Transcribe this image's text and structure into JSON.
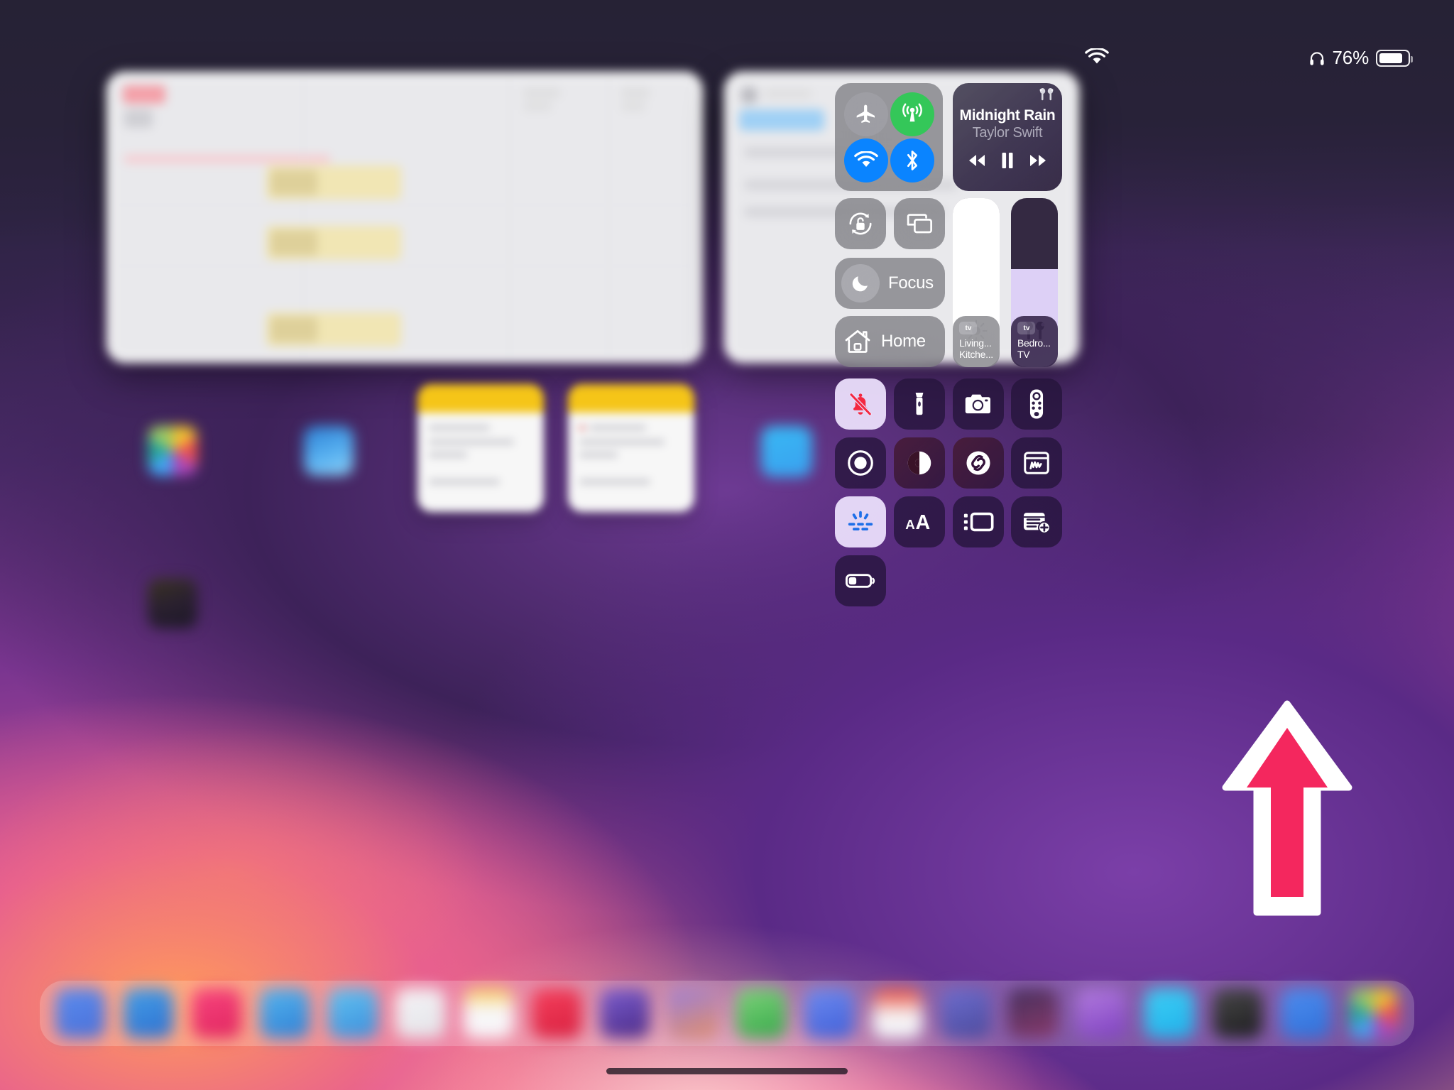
{
  "device": "ipad-control-center",
  "status_bar": {
    "wifi_icon": "wifi-icon",
    "headphones_icon": "headphones-icon",
    "battery_percent": "76%",
    "battery_level": 76
  },
  "control_center": {
    "connectivity": {
      "airplane_mode": {
        "name": "airplane-mode",
        "state": "off"
      },
      "cellular_data": {
        "name": "cellular-data",
        "state": "on"
      },
      "wifi": {
        "name": "wifi",
        "state": "on"
      },
      "bluetooth": {
        "name": "bluetooth",
        "state": "on"
      }
    },
    "media": {
      "track_title": "Midnight Rain",
      "artist": "Taylor Swift",
      "route_icon": "airpods-icon",
      "rewind_label": "Rewind",
      "pause_label": "Pause",
      "forward_label": "Fast Forward"
    },
    "rotation_lock": {
      "label": "Rotation Lock",
      "state": "off"
    },
    "screen_mirroring": {
      "label": "Screen Mirroring"
    },
    "focus": {
      "label": "Focus",
      "state": "off"
    },
    "home": {
      "label": "Home"
    },
    "brightness": {
      "label": "Brightness",
      "value": 100
    },
    "volume": {
      "label": "Volume",
      "value": 58,
      "device_icon": "airpods-icon"
    },
    "tv_remotes": [
      {
        "badge": "tv",
        "line1": "Living...",
        "line2": "Kitche..."
      },
      {
        "badge": "tv",
        "line1": "Bedro...",
        "line2": "TV"
      }
    ],
    "tiles": [
      {
        "name": "silent-mode",
        "icon": "bell-slash-icon",
        "active": true,
        "warm": false
      },
      {
        "name": "flashlight",
        "icon": "flashlight-icon",
        "active": false,
        "warm": false
      },
      {
        "name": "camera",
        "icon": "camera-icon",
        "active": false,
        "warm": false
      },
      {
        "name": "apple-tv-remote",
        "icon": "remote-icon",
        "active": false,
        "warm": false
      },
      {
        "name": "screen-recording",
        "icon": "record-icon",
        "active": false,
        "warm": false
      },
      {
        "name": "dark-mode",
        "icon": "contrast-icon",
        "active": false,
        "warm": true
      },
      {
        "name": "shazam",
        "icon": "shazam-icon",
        "active": false,
        "warm": true
      },
      {
        "name": "quick-note",
        "icon": "notes-scribble-icon",
        "active": false,
        "warm": false
      },
      {
        "name": "keyboard-brightness",
        "icon": "keyboard-light-icon",
        "active": true,
        "warm": false
      },
      {
        "name": "text-size",
        "icon": "text-size-icon",
        "active": false,
        "warm": false
      },
      {
        "name": "stage-manager",
        "icon": "stage-manager-icon",
        "active": false,
        "warm": false
      },
      {
        "name": "add-widget",
        "icon": "add-widget-icon",
        "active": false,
        "warm": false
      },
      {
        "name": "low-power-mode",
        "icon": "battery-low-icon",
        "active": false,
        "warm": false
      }
    ]
  },
  "annotation": {
    "arrow_target": "stage-manager",
    "arrow_color": "#F4275E",
    "arrow_outline": "#FFFFFF"
  },
  "colors": {
    "accent_green": "#34C759",
    "accent_blue": "#0A84FF",
    "module_gray": "rgba(118,118,124,0.72)",
    "active_tile": "#ECE0FC",
    "arrow_red": "#F4275E"
  },
  "home_screen": {
    "app_icons": [
      "photos",
      "weather",
      "notes-widget",
      "reminders-widget",
      "messages",
      "dark-app"
    ],
    "dock_icon_count": 20
  }
}
